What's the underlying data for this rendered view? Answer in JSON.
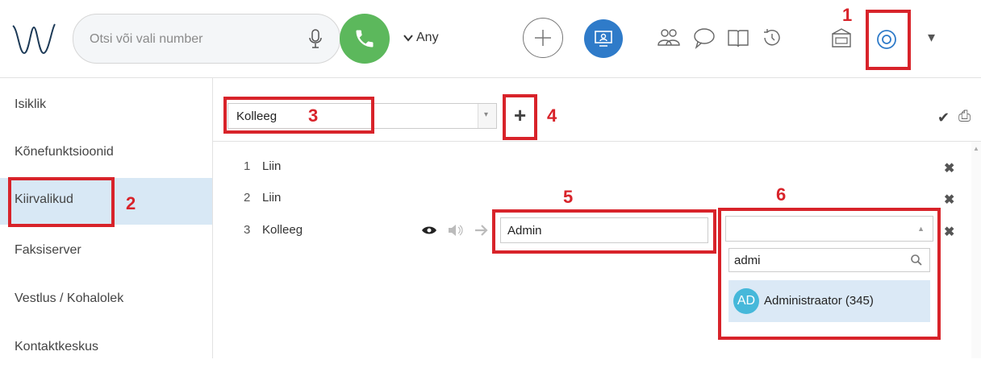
{
  "header": {
    "search_placeholder": "Otsi või vali number",
    "any_label": "Any",
    "dropdown_arrow": "▾",
    "icons": [
      "logo-icon",
      "microphone-icon",
      "phone-icon",
      "chevron-down-icon",
      "plus-icon",
      "presence-icon",
      "contacts-icon",
      "chat-icon",
      "book-icon",
      "history-icon",
      "voicemail-icon",
      "settings-icon",
      "caret-down-icon"
    ]
  },
  "annotations": {
    "n1": "1",
    "n2": "2",
    "n3": "3",
    "n4": "4",
    "n5": "5",
    "n6": "6",
    "color": "#d8232a"
  },
  "sidebar": {
    "items": [
      {
        "label": "Isiklik"
      },
      {
        "label": "Kõnefunktsioonid"
      },
      {
        "label": "Kiirvalikud"
      },
      {
        "label": "Faksiserver"
      },
      {
        "label": "Vestlus / Kohalolek"
      },
      {
        "label": "Kontaktkeskus"
      }
    ],
    "active_color": "#d8e8f5"
  },
  "toolbar": {
    "selected": "Kolleeg",
    "add_symbol": "+",
    "save_symbol": "✔",
    "print_symbol": "⎙"
  },
  "rows": [
    {
      "num": "1",
      "label": "Liin"
    },
    {
      "num": "2",
      "label": "Liin"
    },
    {
      "num": "3",
      "label": "Kolleeg"
    }
  ],
  "row3": {
    "name_value": "Admin",
    "search_value": "admi",
    "option_initials": "AD",
    "option_label": "Administraator (345)"
  },
  "colors": {
    "call_green": "#5cb85c",
    "accent_blue": "#2f7bc9",
    "avatar": "#46b8da"
  }
}
